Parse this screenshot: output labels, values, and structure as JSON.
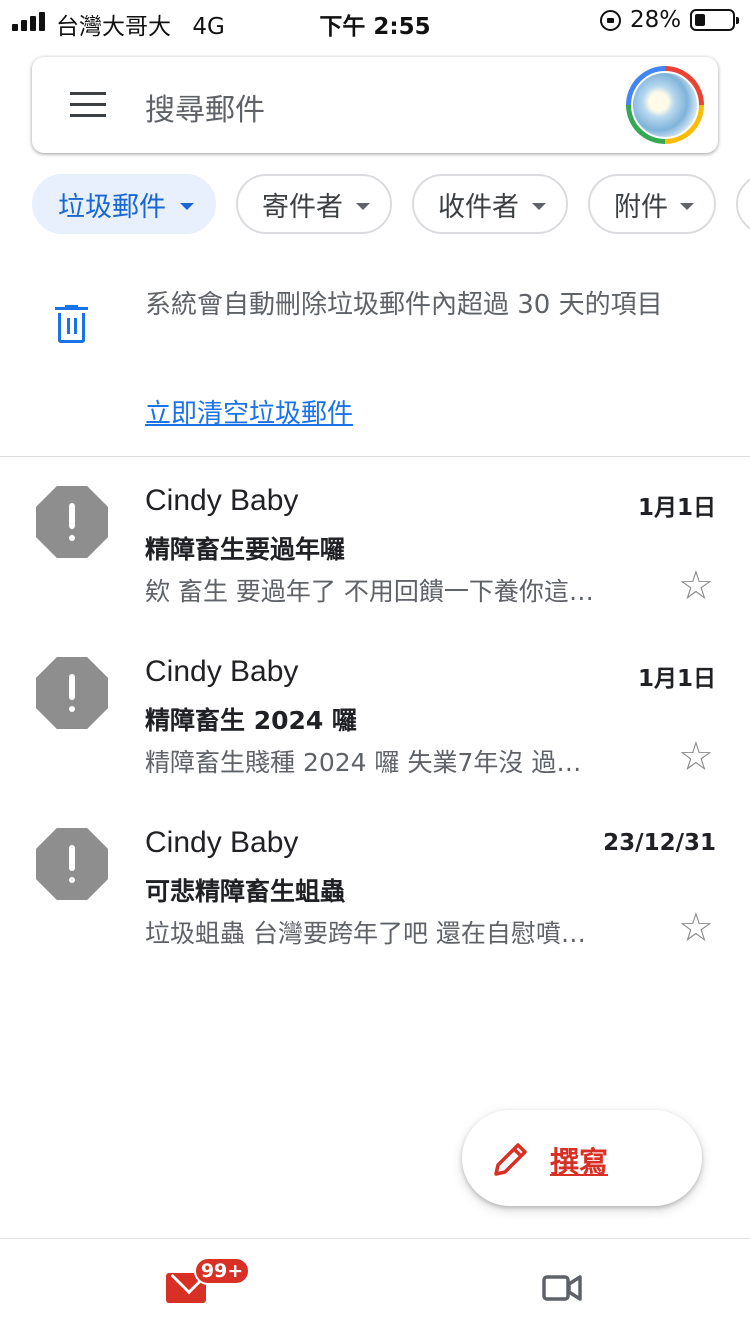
{
  "status_bar": {
    "carrier": "台灣大哥大",
    "network": "4G",
    "time": "下午 2:55",
    "battery": "28%",
    "battery_level": 0.28
  },
  "search": {
    "placeholder": "搜尋郵件"
  },
  "chips": [
    {
      "label": "垃圾郵件",
      "active": true
    },
    {
      "label": "寄件者",
      "active": false
    },
    {
      "label": "收件者",
      "active": false
    },
    {
      "label": "附件",
      "active": false
    }
  ],
  "notice": {
    "text": "系統會自動刪除垃圾郵件內超過 30 天的項目",
    "action": "立即清空垃圾郵件"
  },
  "messages": [
    {
      "sender": "Cindy Baby",
      "date": "1月1日",
      "subject": "精障畜生要過年囉",
      "snippet": "欸 畜生 要過年了 不用回饋一下養你這…",
      "starred": false
    },
    {
      "sender": "Cindy Baby",
      "date": "1月1日",
      "subject": "精障畜生 2024 囉",
      "snippet": "精障畜生賤種 2024 囉 失業7年沒 過…",
      "starred": false
    },
    {
      "sender": "Cindy Baby",
      "date": "23/12/31",
      "subject": "可悲精障畜生蛆蟲",
      "snippet": "垃圾蛆蟲 台灣要跨年了吧 還在自慰噴…",
      "starred": false
    }
  ],
  "compose": {
    "label": "撰寫"
  },
  "bottom_nav": {
    "mail_badge": "99+"
  },
  "colors": {
    "accent_blue": "#1a73e8",
    "compose_red": "#d93025",
    "spam_icon_gray": "#8e8e8e"
  },
  "icons": [
    "menu-icon",
    "trash-icon",
    "spam-warning-icon",
    "star-icon",
    "pencil-icon",
    "mail-icon",
    "video-icon"
  ]
}
